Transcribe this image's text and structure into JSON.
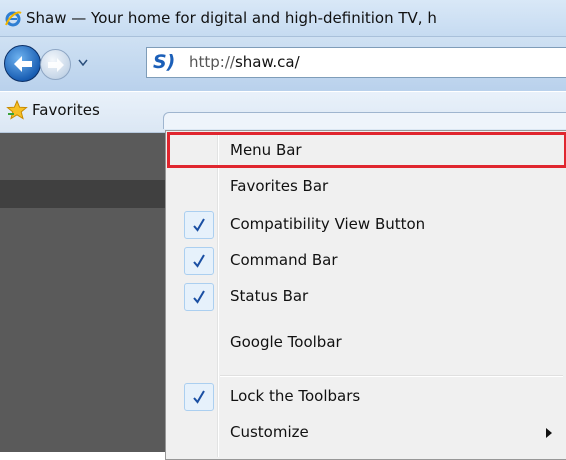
{
  "window": {
    "title": "Shaw — Your home for digital and high-definition TV, h",
    "icon": "ie-icon"
  },
  "navigation": {
    "back_icon": "back-arrow-icon",
    "forward_icon": "forward-arrow-icon",
    "history_dropdown_icon": "chevron-down-icon",
    "site_icon_text": "S)",
    "url_prefix": "http://",
    "url_host": "shaw.ca/"
  },
  "favorites_bar": {
    "label": "Favorites",
    "icon": "star-icon"
  },
  "context_menu": {
    "items": [
      {
        "label": "Menu Bar",
        "checked": false
      },
      {
        "label": "Favorites Bar",
        "checked": false
      },
      {
        "label": "Compatibility View Button",
        "checked": true
      },
      {
        "label": "Command Bar",
        "checked": true
      },
      {
        "label": "Status Bar",
        "checked": true
      },
      {
        "label": "Google Toolbar",
        "checked": false
      },
      {
        "label": "Lock the Toolbars",
        "checked": true
      },
      {
        "label": "Customize",
        "checked": false,
        "submenu": true
      }
    ],
    "highlight_color": "#e0262f",
    "check_color": "#1a4fa3"
  }
}
